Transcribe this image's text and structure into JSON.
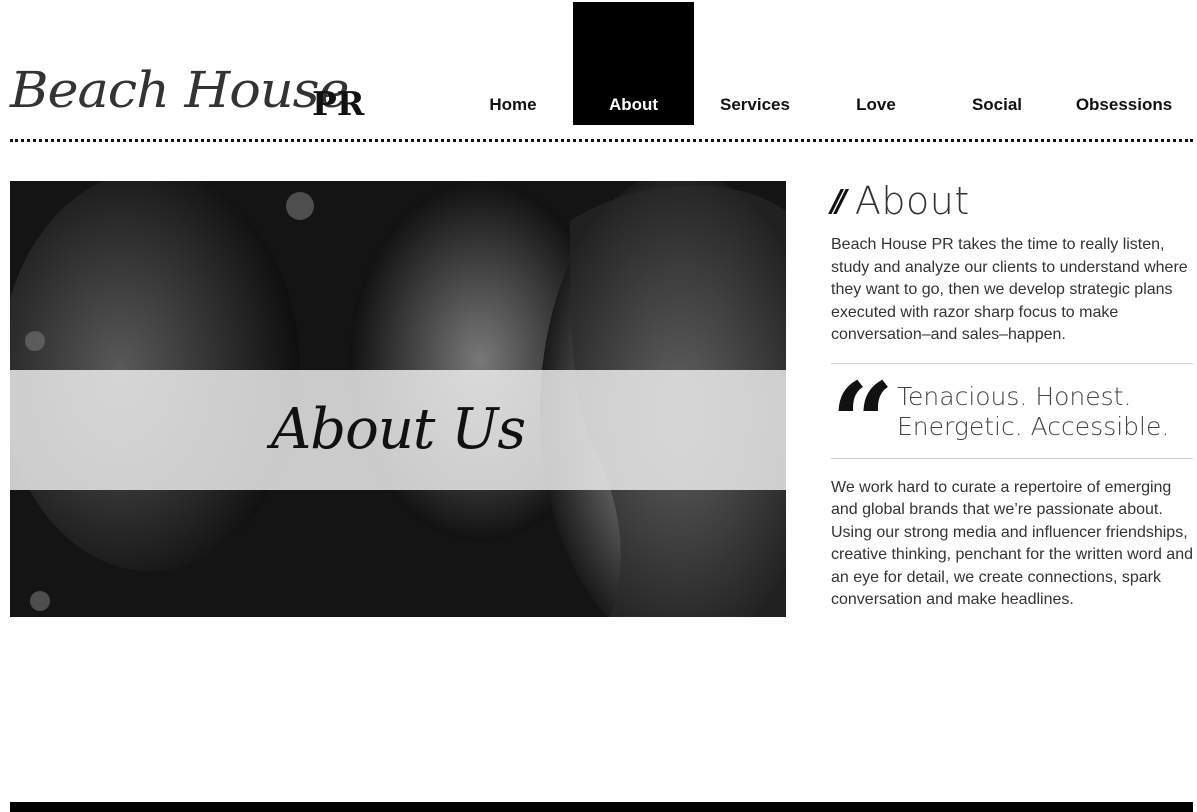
{
  "brand": {
    "script": "Beach House",
    "suffix": "PR"
  },
  "nav": [
    {
      "label": "Home",
      "active": false
    },
    {
      "label": "About",
      "active": true
    },
    {
      "label": "Services",
      "active": false
    },
    {
      "label": "Love",
      "active": false
    },
    {
      "label": "Social",
      "active": false
    },
    {
      "label": "Obsessions",
      "active": false
    }
  ],
  "hero": {
    "title": "About Us"
  },
  "about": {
    "title": "About",
    "paragraph1": "Beach House PR takes the time to really listen, study and analyze our clients to understand where they want to go, then we develop strategic plans executed with razor sharp focus to make conversation–and sales–happen.",
    "quote_line1": "Tenacious. Honest.",
    "quote_line2": "Energetic. Accessible.",
    "paragraph2": "We work hard to curate a repertoire of emerging and global brands that we’re passionate about. Using our strong media and influencer friendships, creative thinking, penchant for the written word and an eye for detail, we create connections, spark conversation and make headlines."
  },
  "colors": {
    "accent": "#000000",
    "text": "#333333",
    "band": "#ebebeb"
  }
}
